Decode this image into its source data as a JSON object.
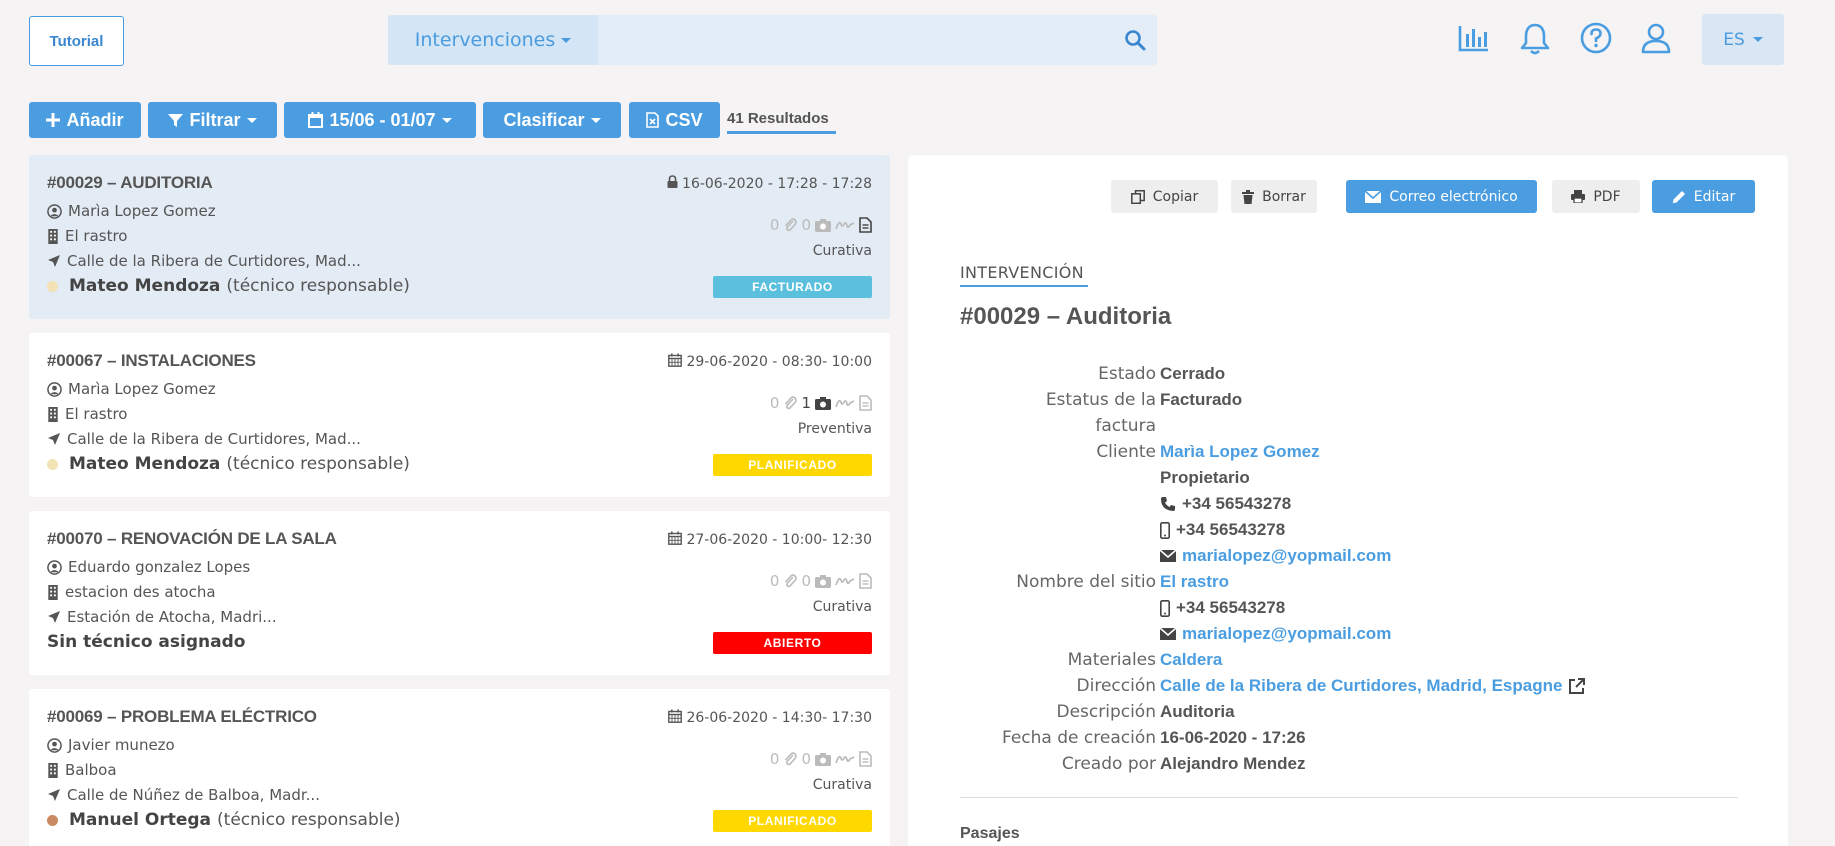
{
  "header": {
    "tutorial_label": "Tutorial",
    "search_select_label": "Intervenciones",
    "search_placeholder": "",
    "lang_label": "ES",
    "icons": [
      "chart-icon",
      "bell-icon",
      "help-icon",
      "user-icon"
    ]
  },
  "toolbar": {
    "add_label": "Añadir",
    "filter_label": "Filtrar",
    "date_range_label": "15/06 - 01/07",
    "sort_label": "Clasificar",
    "csv_label": "CSV",
    "results_label": "41 Resultados"
  },
  "colors": {
    "accent": "#4a9de0",
    "badge_facturado": "#5bc0de",
    "badge_planificado": "#ffd800",
    "badge_abierto": "#ff0000"
  },
  "list": [
    {
      "title": "#00029 – AUDITORIA",
      "date": "16-06-2020 - 17:28 - 17:28",
      "date_icon": "lock-icon",
      "client": "Marìa Lopez Gomez",
      "site": "El rastro",
      "address": "Calle de la Ribera de Curtidores, Mad...",
      "tech_name": "Mateo Mendoza",
      "tech_role": "(técnico responsable)",
      "tech_dot_color": "#f3e2b3",
      "attachments": "0",
      "photos": "0",
      "type": "Curativa",
      "status": "FACTURADO",
      "status_color": "#5bc0de"
    },
    {
      "title": "#00067 – INSTALACIONES",
      "date": "29-06-2020 - 08:30- 10:00",
      "date_icon": "calendar-icon",
      "client": "Marìa Lopez Gomez",
      "site": "El rastro",
      "address": "Calle de la Ribera de Curtidores, Mad...",
      "tech_name": "Mateo Mendoza",
      "tech_role": "(técnico responsable)",
      "tech_dot_color": "#f3e2b3",
      "attachments": "0",
      "photos": "1",
      "type": "Preventiva",
      "status": "PLANIFICADO",
      "status_color": "#ffd800"
    },
    {
      "title": "#00070 – RENOVACIÓN DE LA SALA",
      "date": "27-06-2020 - 10:00- 12:30",
      "date_icon": "calendar-icon",
      "client": "Eduardo gonzalez Lopes",
      "site": "estacion des atocha",
      "address": "Estación de Atocha, Madri...",
      "tech_name": "Sin técnico asignado",
      "tech_role": "",
      "tech_dot_color": "",
      "attachments": "0",
      "photos": "0",
      "type": "Curativa",
      "status": "ABIERTO",
      "status_color": "#ff0000"
    },
    {
      "title": "#00069 – PROBLEMA ELÉCTRICO",
      "date": "26-06-2020 - 14:30- 17:30",
      "date_icon": "calendar-icon",
      "client": "Javier munezo",
      "site": "Balboa",
      "address": "Calle de Núñez de Balboa, Madr...",
      "tech_name": "Manuel Ortega",
      "tech_role": "(técnico responsable)",
      "tech_dot_color": "#c98a63",
      "attachments": "0",
      "photos": "0",
      "type": "Curativa",
      "status": "PLANIFICADO",
      "status_color": "#ffd800"
    }
  ],
  "detail": {
    "actions": {
      "copy_label": "Copiar",
      "delete_label": "Borrar",
      "email_label": "Correo electrónico",
      "pdf_label": "PDF",
      "edit_label": "Editar"
    },
    "section_tag": "INTERVENCIÓN",
    "title": "#00029 – Auditoria",
    "labels": {
      "estado": "Estado",
      "estatus_1": "Estatus de la",
      "estatus_2": "factura",
      "cliente": "Cliente",
      "sitio": "Nombre del sitio",
      "materiales": "Materiales",
      "direccion": "Dirección",
      "descripcion": "Descripción",
      "fecha": "Fecha de creación",
      "creado": "Creado por"
    },
    "values": {
      "estado": "Cerrado",
      "estatus": "Facturado",
      "cliente": "Marìa Lopez Gomez",
      "cliente_rol": "Propietario",
      "cliente_phone": "+34 56543278",
      "cliente_mobile": "+34 56543278",
      "cliente_email": "marialopez@yopmail.com",
      "sitio": "El rastro",
      "sitio_mobile": "+34 56543278",
      "sitio_email": "marialopez@yopmail.com",
      "materiales": "Caldera",
      "direccion": "Calle de la Ribera de Curtidores, Madrid, Espagne",
      "descripcion": "Auditoria",
      "fecha": "16-06-2020 - 17:26",
      "creado": "Alejandro Mendez"
    },
    "pasajes_label": "Pasajes"
  }
}
